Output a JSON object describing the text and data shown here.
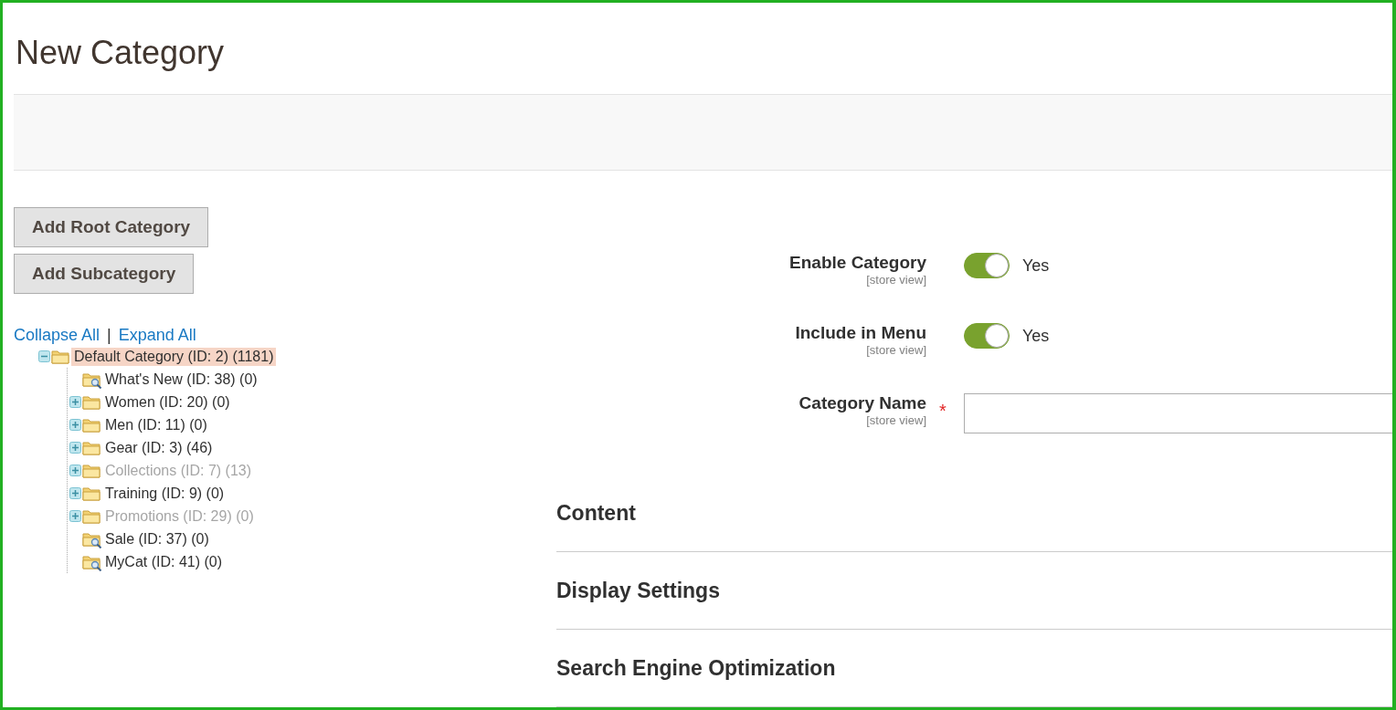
{
  "page_title": "New Category",
  "buttons": [
    "Add Root Category",
    "Add Subcategory"
  ],
  "tree_links": [
    "Collapse All",
    "Expand All"
  ],
  "tree_separator": "|",
  "tree": [
    {
      "label": "Default Category (ID: 2) (1181)",
      "kind": "folder",
      "expanded": true,
      "selected": true,
      "disabled": false,
      "children": [
        {
          "label": "What's New (ID: 38) (0)",
          "kind": "leaf",
          "selected": false,
          "disabled": false
        },
        {
          "label": "Women (ID: 20) (0)",
          "kind": "folder",
          "expanded": false,
          "selected": false,
          "disabled": false
        },
        {
          "label": "Men (ID: 11) (0)",
          "kind": "folder",
          "expanded": false,
          "selected": false,
          "disabled": false
        },
        {
          "label": "Gear (ID: 3) (46)",
          "kind": "folder",
          "expanded": false,
          "selected": false,
          "disabled": false
        },
        {
          "label": "Collections (ID: 7) (13)",
          "kind": "folder",
          "expanded": false,
          "selected": false,
          "disabled": true
        },
        {
          "label": "Training (ID: 9) (0)",
          "kind": "folder",
          "expanded": false,
          "selected": false,
          "disabled": false
        },
        {
          "label": "Promotions (ID: 29) (0)",
          "kind": "folder",
          "expanded": false,
          "selected": false,
          "disabled": true
        },
        {
          "label": "Sale (ID: 37) (0)",
          "kind": "leaf",
          "selected": false,
          "disabled": false
        },
        {
          "label": "MyCat (ID: 41) (0)",
          "kind": "leaf",
          "selected": false,
          "disabled": false
        }
      ]
    }
  ],
  "fields": [
    {
      "kind": "toggle",
      "label": "Enable Category",
      "scope": "[store view]",
      "on": true,
      "value": "Yes"
    },
    {
      "kind": "toggle",
      "label": "Include in Menu",
      "scope": "[store view]",
      "on": true,
      "value": "Yes"
    },
    {
      "kind": "text",
      "label": "Category Name",
      "scope": "[store view]",
      "required_mark": "*"
    }
  ],
  "sections": [
    "Content",
    "Display Settings",
    "Search Engine Optimization"
  ]
}
